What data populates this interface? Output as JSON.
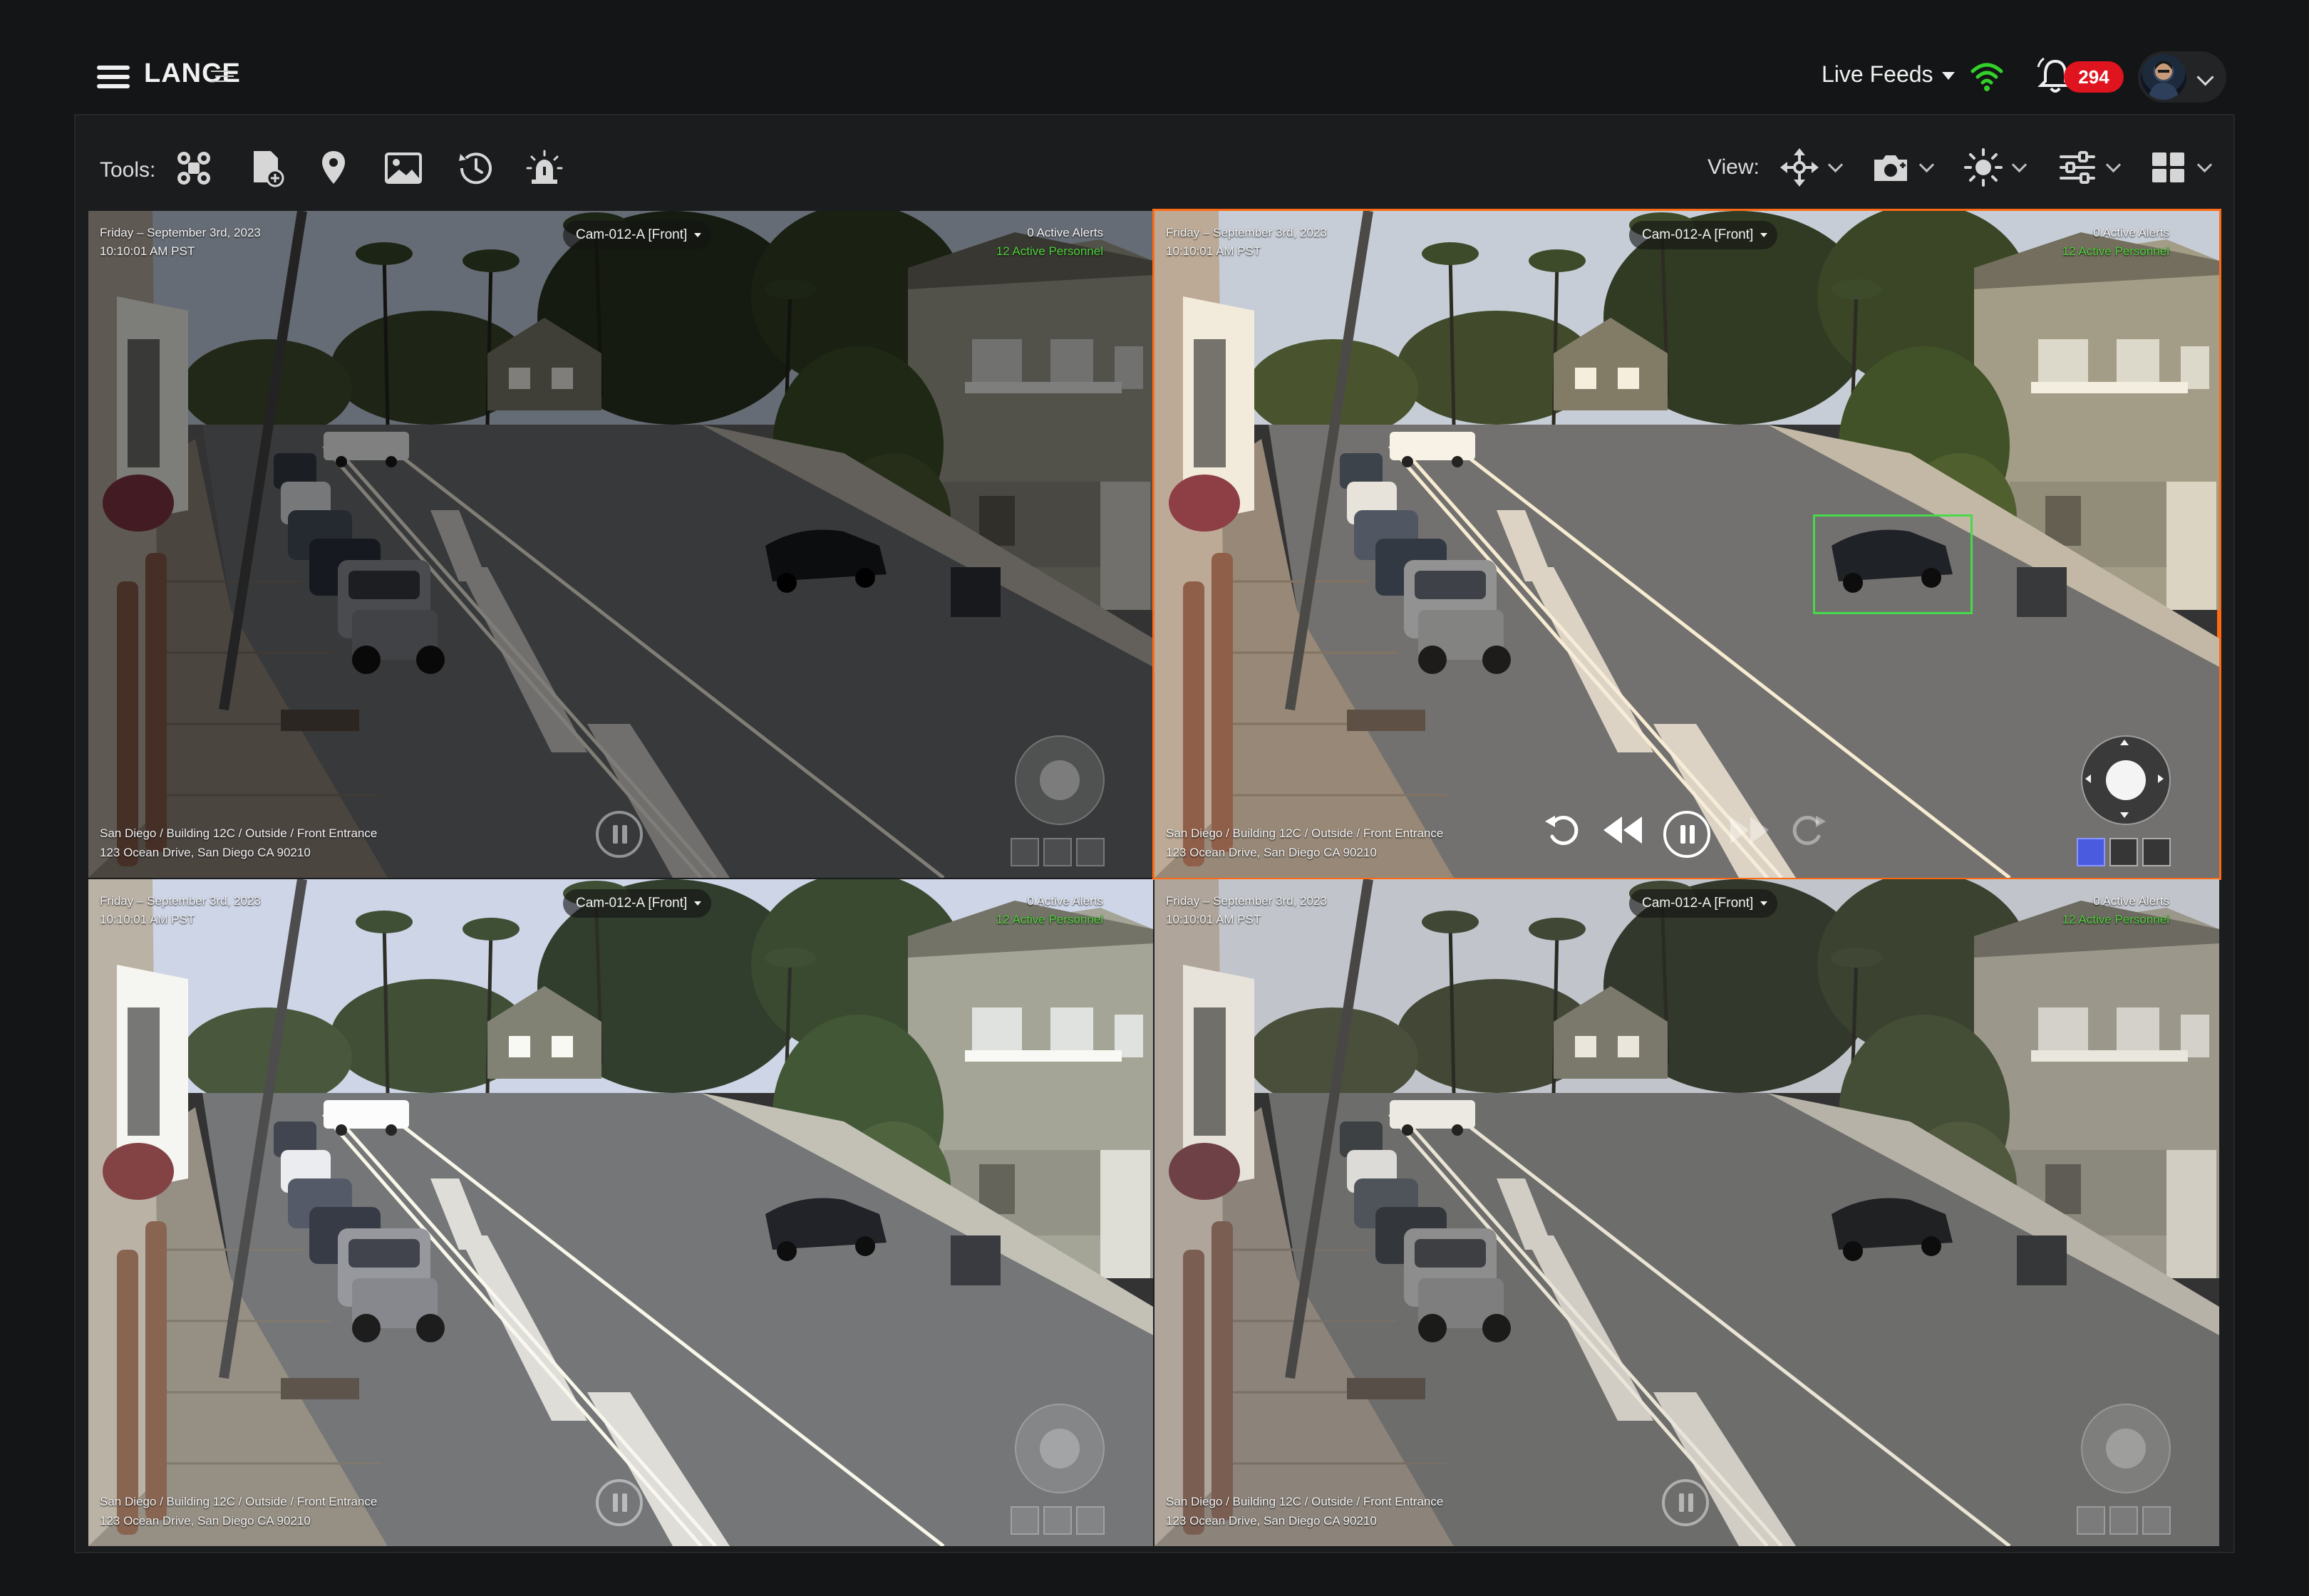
{
  "header": {
    "brand": "LANCE",
    "live_feeds_label": "Live Feeds",
    "notification_count": "294"
  },
  "toolbar": {
    "tools_label": "Tools:",
    "view_label": "View:",
    "tools": [
      "drone-icon",
      "document-add-icon",
      "map-pin-icon",
      "image-icon",
      "history-icon",
      "alarm-icon"
    ],
    "view_buttons": [
      "move-arrows-icon",
      "camera-add-icon",
      "brightness-icon",
      "sliders-icon",
      "grid-layout-icon"
    ]
  },
  "feeds": [
    {
      "date": "Friday – September 3rd, 2023",
      "time": "10:10:01 AM PST",
      "camera": "Cam-012-A [Front]",
      "alerts": "0 Active Alerts",
      "personnel": "12 Active Personnel",
      "path": "San Diego / Building 12C / Outside / Front Entrance",
      "address": "123 Ocean Drive, San Diego CA 90210"
    },
    {
      "date": "Friday – September 3rd, 2023",
      "time": "10:10:01 AM PST",
      "camera": "Cam-012-A [Front]",
      "alerts": "0 Active Alerts",
      "personnel": "12 Active Personnel",
      "path": "San Diego / Building 12C / Outside / Front Entrance",
      "address": "123 Ocean Drive, San Diego CA 90210"
    },
    {
      "date": "Friday – September 3rd, 2023",
      "time": "10:10:01 AM PST",
      "camera": "Cam-012-A [Front]",
      "alerts": "0 Active Alerts",
      "personnel": "12 Active Personnel",
      "path": "San Diego / Building 12C / Outside / Front Entrance",
      "address": "123 Ocean Drive, San Diego CA 90210"
    },
    {
      "date": "Friday – September 3rd, 2023",
      "time": "10:10:01 AM PST",
      "camera": "Cam-012-A [Front]",
      "alerts": "0 Active Alerts",
      "personnel": "12 Active Personnel",
      "path": "San Diego / Building 12C / Outside / Front Entrance",
      "address": "123 Ocean Drive, San Diego CA 90210"
    }
  ],
  "colors": {
    "accent_selected": "#ff6a13",
    "alert_badge": "#e0141e",
    "status_green": "#4fd13b",
    "detection_box": "#47d84b"
  }
}
